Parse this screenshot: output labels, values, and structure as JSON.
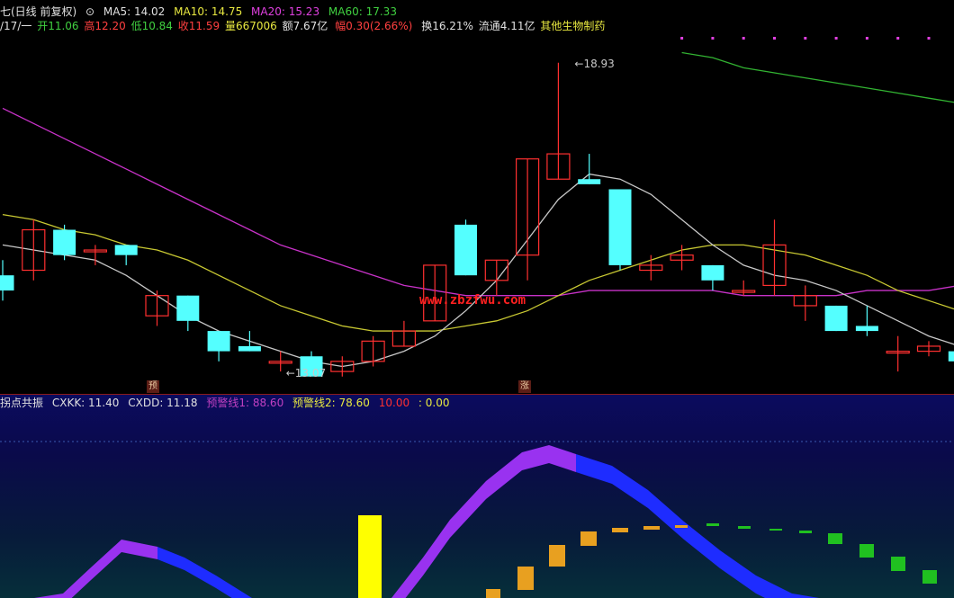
{
  "header": {
    "title_prefix": "七(日线 前复权)",
    "ma5": "MA5: 14.02",
    "ma10": "MA10: 14.75",
    "ma20": "MA20: 15.23",
    "ma60": "MA60: 17.33"
  },
  "quote": {
    "date": "/17/一",
    "open": "开11.06",
    "high": "高12.20",
    "low": "低10.84",
    "close": "收11.59",
    "volume": "量667006",
    "amount": "额7.67亿",
    "change": "幅0.30(2.66%)",
    "turnover": "换16.21%",
    "float": "流通4.11亿",
    "sector": "其他生物制药"
  },
  "annotations": {
    "high_price": "18.93",
    "low_price": "13.07",
    "watermark": "www.zbzfwu.com",
    "marker_a": "预",
    "marker_b": "涨"
  },
  "indicator": {
    "name": "拐点共振",
    "cxkk": "CXKK: 11.40",
    "cxdd": "CXDD: 11.18",
    "warn1": "预警线1: 88.60",
    "warn2": "预警线2: 78.60",
    "v10": "10.00",
    "v0": ": 0.00"
  },
  "colors": {
    "up": "#ff3030",
    "down": "#54ffff",
    "ma5": "#c8c8c8",
    "ma10": "#c8c832",
    "ma20": "#c832c8",
    "ma60": "#32b432",
    "purple_band": "#9932f0",
    "blue_band": "#1e2cff",
    "yellow_bar": "#ffff00",
    "orange_bar": "#e8a020",
    "green_bar": "#20c020"
  },
  "chart_data": {
    "type": "candlestick",
    "y_range": [
      12.5,
      19.5
    ],
    "candles": [
      {
        "o": 14.7,
        "h": 15.0,
        "l": 14.2,
        "c": 14.4
      },
      {
        "o": 14.8,
        "h": 15.8,
        "l": 14.6,
        "c": 15.6
      },
      {
        "o": 15.6,
        "h": 15.7,
        "l": 15.0,
        "c": 15.1
      },
      {
        "o": 15.2,
        "h": 15.3,
        "l": 14.9,
        "c": 15.2
      },
      {
        "o": 15.3,
        "h": 15.3,
        "l": 14.9,
        "c": 15.1
      },
      {
        "o": 13.9,
        "h": 14.4,
        "l": 13.7,
        "c": 14.3
      },
      {
        "o": 14.3,
        "h": 14.3,
        "l": 13.6,
        "c": 13.8
      },
      {
        "o": 13.6,
        "h": 13.6,
        "l": 13.0,
        "c": 13.2
      },
      {
        "o": 13.3,
        "h": 13.6,
        "l": 13.2,
        "c": 13.2
      },
      {
        "o": 13.0,
        "h": 13.2,
        "l": 12.8,
        "c": 13.0
      },
      {
        "o": 13.1,
        "h": 13.2,
        "l": 12.8,
        "c": 12.7
      },
      {
        "o": 12.8,
        "h": 13.1,
        "l": 12.7,
        "c": 13.0
      },
      {
        "o": 13.0,
        "h": 13.5,
        "l": 12.9,
        "c": 13.4
      },
      {
        "o": 13.3,
        "h": 13.8,
        "l": 13.3,
        "c": 13.6
      },
      {
        "o": 13.8,
        "h": 14.9,
        "l": 13.8,
        "c": 14.9
      },
      {
        "o": 15.7,
        "h": 15.8,
        "l": 14.7,
        "c": 14.7
      },
      {
        "o": 14.6,
        "h": 15.0,
        "l": 14.3,
        "c": 15.0
      },
      {
        "o": 15.1,
        "h": 17.0,
        "l": 14.6,
        "c": 17.0
      },
      {
        "o": 16.6,
        "h": 18.9,
        "l": 16.6,
        "c": 17.1
      },
      {
        "o": 16.6,
        "h": 17.1,
        "l": 16.5,
        "c": 16.5
      },
      {
        "o": 16.4,
        "h": 16.4,
        "l": 14.8,
        "c": 14.9
      },
      {
        "o": 14.8,
        "h": 15.1,
        "l": 14.6,
        "c": 14.9
      },
      {
        "o": 15.0,
        "h": 15.3,
        "l": 14.8,
        "c": 15.1
      },
      {
        "o": 14.9,
        "h": 14.9,
        "l": 14.4,
        "c": 14.6
      },
      {
        "o": 14.4,
        "h": 14.6,
        "l": 14.3,
        "c": 14.4
      },
      {
        "o": 14.5,
        "h": 15.8,
        "l": 14.3,
        "c": 15.3
      },
      {
        "o": 14.1,
        "h": 14.5,
        "l": 13.8,
        "c": 14.3
      },
      {
        "o": 14.1,
        "h": 14.1,
        "l": 13.6,
        "c": 13.6
      },
      {
        "o": 13.7,
        "h": 14.1,
        "l": 13.5,
        "c": 13.6
      },
      {
        "o": 13.2,
        "h": 13.5,
        "l": 12.8,
        "c": 13.2
      },
      {
        "o": 13.2,
        "h": 13.4,
        "l": 13.1,
        "c": 13.3
      },
      {
        "o": 13.2,
        "h": 13.2,
        "l": 13.0,
        "c": 13.0
      }
    ],
    "ma5": [
      15.3,
      15.2,
      15.1,
      15.0,
      14.7,
      14.3,
      13.9,
      13.6,
      13.4,
      13.2,
      13.0,
      12.9,
      13.0,
      13.2,
      13.5,
      14.0,
      14.6,
      15.4,
      16.2,
      16.7,
      16.6,
      16.3,
      15.8,
      15.3,
      14.9,
      14.7,
      14.6,
      14.4,
      14.1,
      13.8,
      13.5,
      13.3
    ],
    "ma10": [
      15.9,
      15.8,
      15.6,
      15.5,
      15.3,
      15.2,
      15.0,
      14.7,
      14.4,
      14.1,
      13.9,
      13.7,
      13.6,
      13.6,
      13.6,
      13.7,
      13.8,
      14.0,
      14.3,
      14.6,
      14.8,
      15.0,
      15.2,
      15.3,
      15.3,
      15.2,
      15.1,
      14.9,
      14.7,
      14.4,
      14.2,
      14.0
    ],
    "ma20": [
      18.0,
      17.7,
      17.4,
      17.1,
      16.8,
      16.5,
      16.2,
      15.9,
      15.6,
      15.3,
      15.1,
      14.9,
      14.7,
      14.5,
      14.4,
      14.3,
      14.3,
      14.3,
      14.3,
      14.4,
      14.4,
      14.4,
      14.4,
      14.4,
      14.3,
      14.3,
      14.3,
      14.3,
      14.4,
      14.4,
      14.4,
      14.5
    ],
    "ma60_x": [
      22,
      23,
      24,
      25,
      26,
      27,
      28,
      29,
      30,
      31
    ],
    "ma60": [
      19.1,
      19.0,
      18.8,
      18.7,
      18.6,
      18.5,
      18.4,
      18.3,
      18.2,
      18.1
    ],
    "signal_x": [
      22,
      23,
      24,
      25,
      26,
      27,
      28,
      29,
      30,
      31
    ],
    "signal_value": [
      90,
      88,
      89,
      90,
      88,
      85,
      82,
      78,
      72,
      67
    ],
    "indicator_values": {
      "purple_upper": [
        2,
        6,
        20,
        30,
        26,
        18,
        8,
        2,
        0,
        0,
        0,
        0,
        0,
        10,
        40,
        60,
        82,
        90,
        88
      ],
      "yellow_bar_index": 11,
      "yellow_bar_value": 50,
      "orange_bars": [
        [
          15,
          2
        ],
        [
          16,
          18
        ],
        [
          17,
          28
        ],
        [
          18,
          40
        ],
        [
          19,
          44
        ],
        [
          20,
          47
        ],
        [
          21,
          47
        ]
      ],
      "green_bars": [
        [
          22,
          46
        ],
        [
          23,
          45
        ],
        [
          24,
          44
        ],
        [
          25,
          42
        ],
        [
          26,
          40
        ],
        [
          27,
          35
        ],
        [
          28,
          30
        ],
        [
          29,
          26
        ],
        [
          30,
          23
        ]
      ]
    }
  }
}
